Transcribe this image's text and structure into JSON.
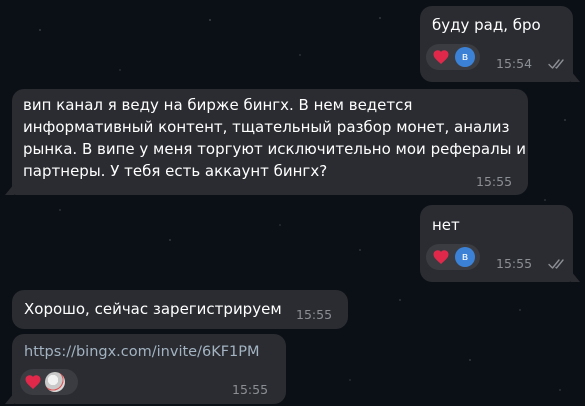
{
  "colors": {
    "bubble": "#2a2c31",
    "reaction_bg": "#3a3c42",
    "heart": "#e0294a",
    "avatar": "#3b82d6",
    "meta": "#8b8e94",
    "link": "#a3b3c2"
  },
  "messages": [
    {
      "side": "outgoing",
      "text": "буду рад, бро",
      "time": "15:54",
      "read": true,
      "reactions": [
        {
          "icon": "heart-icon"
        },
        {
          "avatar_initial": "в"
        }
      ]
    },
    {
      "side": "incoming",
      "text": "вип канал я веду на бирже бингх. В нем ведется информативный контент, тщательный разбор монет, анализ рынка. В випе у меня торгуют исключительно мои рефералы и партнеры. У тебя есть аккаунт бингх?",
      "lines": [
        "вип канал я веду на бирже бингх. В нем ведется",
        "информативный контент, тщательный разбор монет, анализ",
        "рынка. В випе у меня торгуют исключительно мои рефералы и",
        "партнеры. У тебя есть аккаунт бингх?"
      ],
      "time": "15:55"
    },
    {
      "side": "outgoing",
      "text": "нет",
      "time": "15:55",
      "read": true,
      "reactions": [
        {
          "icon": "heart-icon"
        },
        {
          "avatar_initial": "в"
        }
      ]
    },
    {
      "side": "incoming",
      "text": "Хорошо, сейчас зарегистрируем",
      "time": "15:55"
    },
    {
      "side": "incoming",
      "text": "https://bingx.com/invite/6KF1PM",
      "is_link": true,
      "time": "15:55",
      "reactions": [
        {
          "icon": "heart-icon"
        },
        {
          "avatar": "photo"
        }
      ]
    }
  ]
}
